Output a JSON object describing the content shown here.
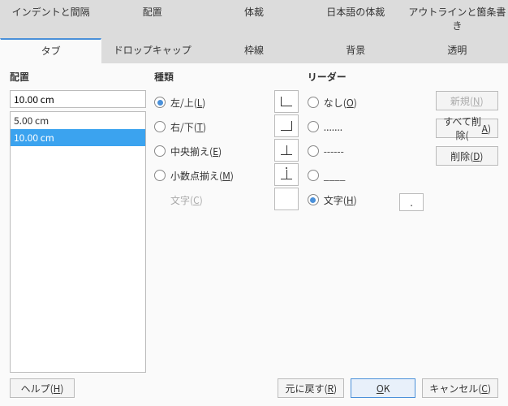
{
  "tabs": {
    "row1": [
      "インデントと間隔",
      "配置",
      "体裁",
      "日本語の体裁",
      "アウトラインと箇条書き"
    ],
    "row2": [
      "タブ",
      "ドロップキャップ",
      "枠線",
      "背景",
      "透明"
    ],
    "active": "タブ"
  },
  "position": {
    "title": "配置",
    "value": "10.00 cm",
    "items": [
      "5.00 cm",
      "10.00 cm"
    ],
    "selected_index": 1
  },
  "type": {
    "title": "種類",
    "options": {
      "left": "左/上(L)",
      "right": "右/下(T)",
      "center": "中央揃え(E)",
      "decimal": "小数点揃え(M)"
    },
    "selected": "left",
    "char_label": "文字(C)",
    "char_value": ""
  },
  "leader": {
    "title": "リーダー",
    "options": {
      "none": "なし(O)",
      "dots": ".......",
      "dashes": "------",
      "underline": "____",
      "char": "文字(H)"
    },
    "selected": "char",
    "char_value": "."
  },
  "side_buttons": {
    "new": "新規(N)",
    "delete_all": "すべて削除(A)",
    "delete": "削除(D)"
  },
  "bottom_buttons": {
    "help": "ヘルプ(H)",
    "reset": "元に戻す(R)",
    "ok": "OK",
    "cancel": "キャンセル(C)"
  }
}
